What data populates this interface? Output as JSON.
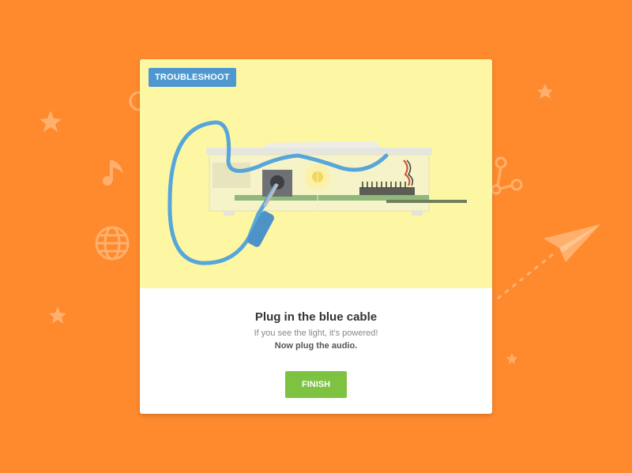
{
  "theme": {
    "background": "#FF8A2E",
    "card": "#FFFFFF",
    "illustration_bg": "#FDF7A3",
    "accent": "#4F97D0",
    "success": "#7DC341"
  },
  "card": {
    "tag_label": "TROUBLESHOOT",
    "title": "Plug in the blue cable",
    "subtitle": "If you see the light, it's powered!",
    "instruction": "Now plug the audio.",
    "finish_label": "FINISH"
  },
  "background_icons": [
    "star-icon",
    "music-note-icon",
    "globe-icon",
    "share-icon",
    "paper-plane-icon"
  ]
}
